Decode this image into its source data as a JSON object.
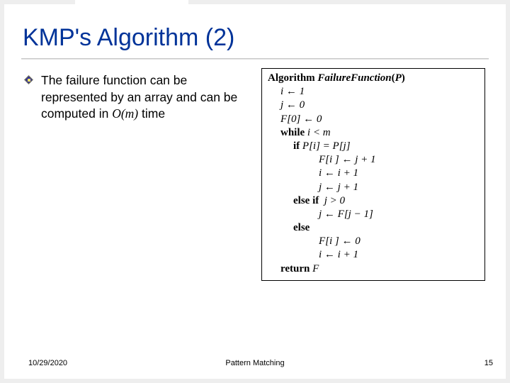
{
  "title": "KMP's Algorithm (2)",
  "bullet_text_pre": "The failure function can be represented by an array and can be computed in ",
  "bullet_text_om": "O(m)",
  "bullet_text_post": " time",
  "algo": {
    "l0_kw": "Algorithm ",
    "l0_fn": "FailureFunction",
    "l0_arg_open": "(",
    "l0_arg": "P",
    "l0_arg_close": ")",
    "l1": "i ← 1",
    "l2": "j ← 0",
    "l3": "F[0] ← 0",
    "l4_kw": "while ",
    "l4_cond": "i < m",
    "l5_kw": "if ",
    "l5_cond": "P[i] = P[j]",
    "l6": "F[i ] ← j + 1",
    "l7": "i ← i + 1",
    "l8": "j ← j + 1",
    "l9_kw": "else if  ",
    "l9_cond": "j > 0",
    "l10": "j ← F[j − 1]",
    "l11_kw": "else",
    "l12": "F[i ] ← 0",
    "l13": "i ← i + 1",
    "l14_kw": "return ",
    "l14_val": "F"
  },
  "footer": {
    "date": "10/29/2020",
    "center": "Pattern Matching",
    "page": "15"
  }
}
